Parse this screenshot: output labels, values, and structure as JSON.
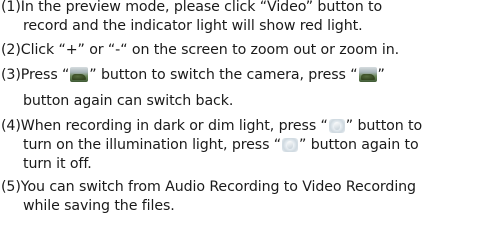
{
  "instructions": {
    "step1": {
      "line1": "(1)In the preview mode, please click “Video” button to",
      "line2": "record and the indicator light will show red light."
    },
    "step2": {
      "line1": "(2)Click “+” or “-“ on the screen to zoom out or zoom in."
    },
    "step3": {
      "line1_before": "(3)Press “",
      "line1_mid": "” button to switch the camera, press “",
      "line1_after": "”",
      "line2": "button again can switch back.",
      "icon": "camera-switch-icon"
    },
    "step4": {
      "line1_before": "(4)When recording in dark or dim light, press “",
      "line1_after": "” button to",
      "line2_before": "turn on the illumination light, press “",
      "line2_after": "” button again to",
      "line3": "turn it off.",
      "icon": "illumination-light-icon"
    },
    "step5": {
      "line1": "(5)You can switch from Audio Recording to Video Recording",
      "line2": "while saving the files."
    }
  }
}
